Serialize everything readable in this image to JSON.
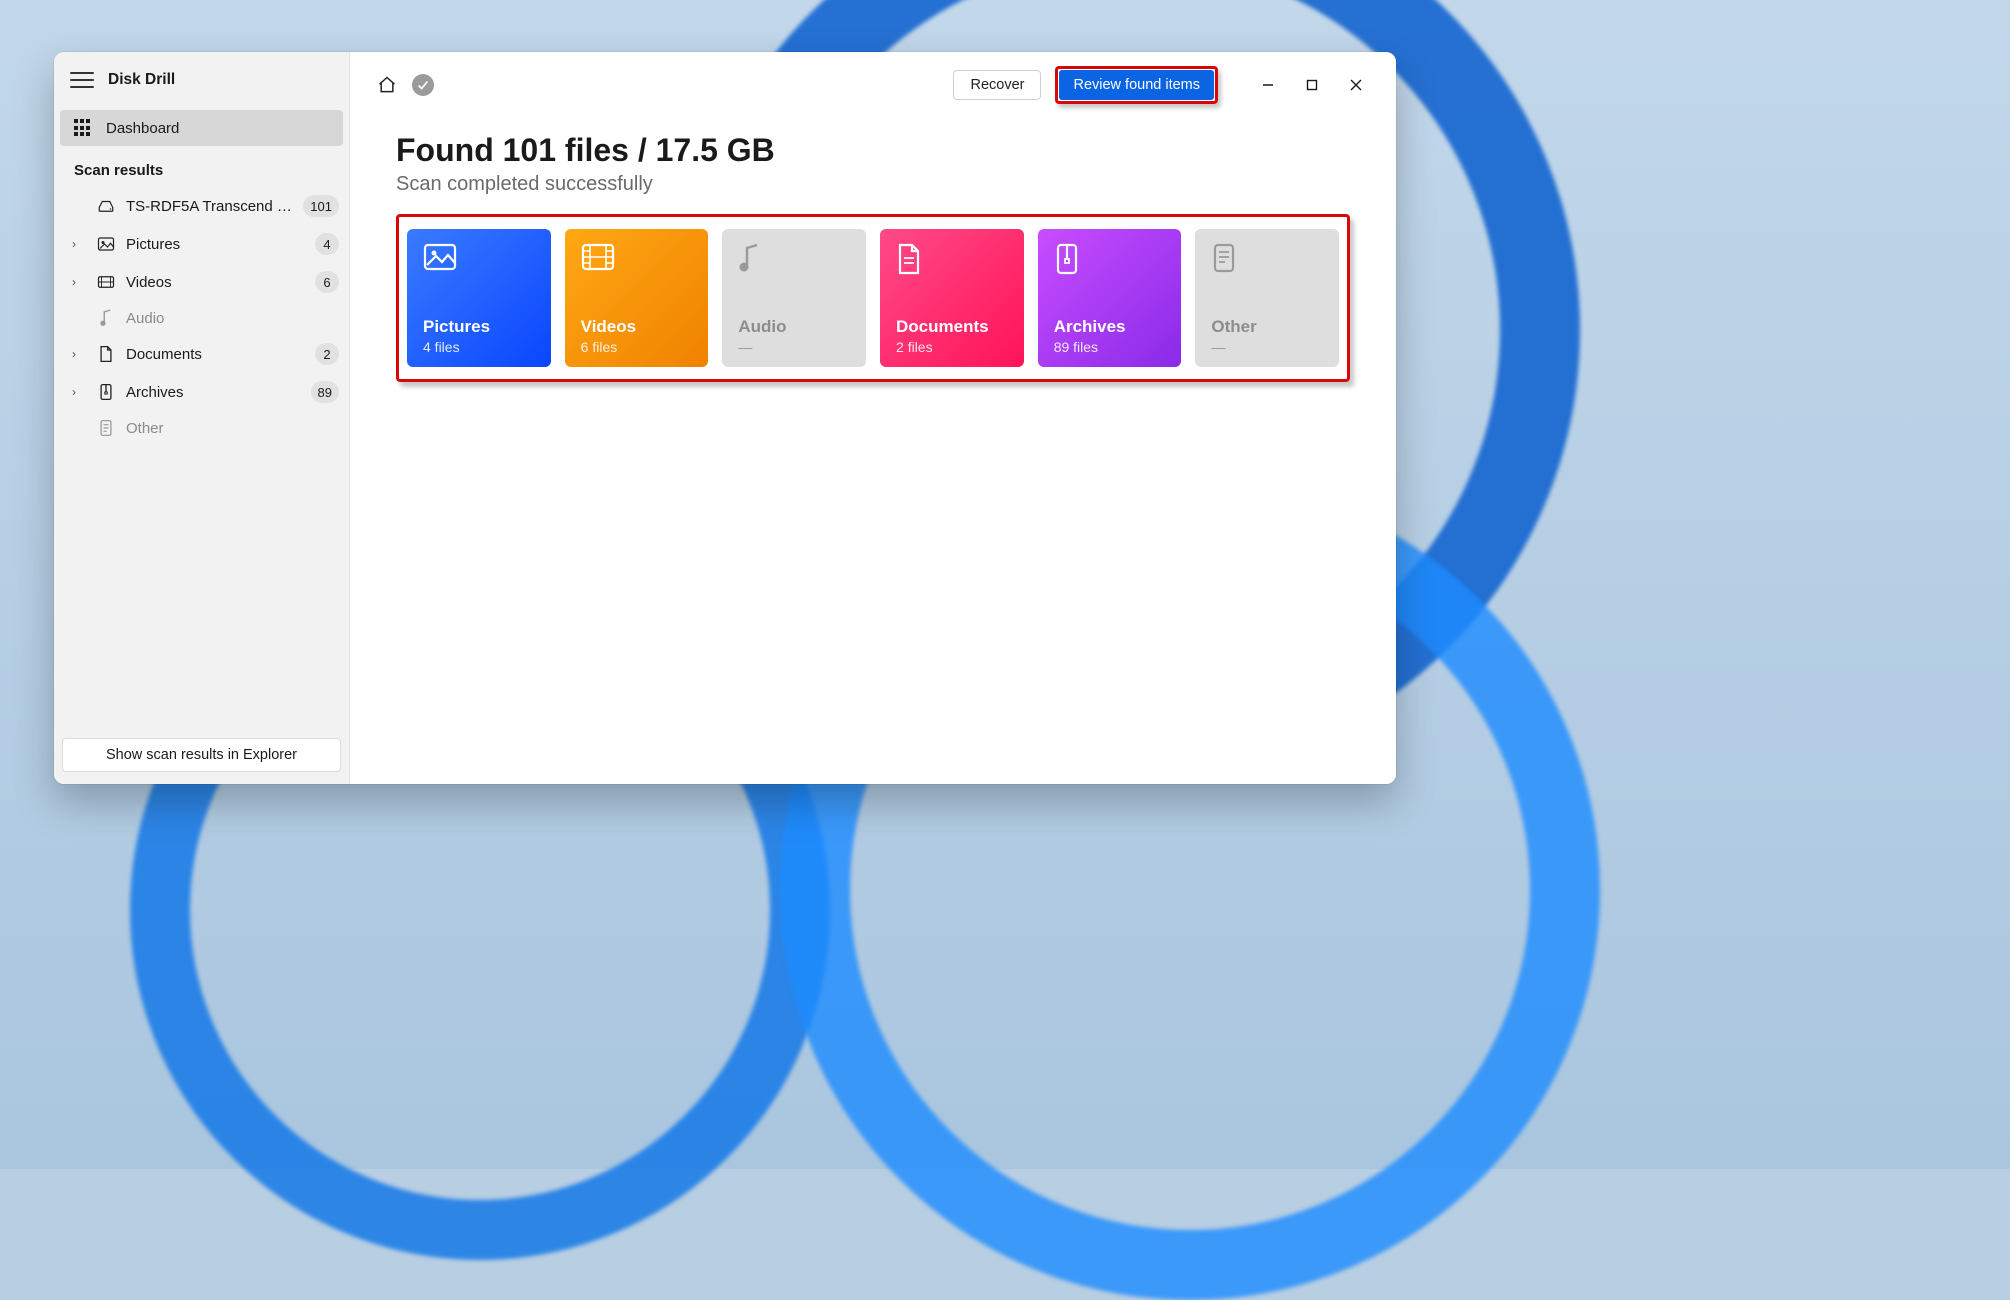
{
  "app": {
    "title": "Disk Drill"
  },
  "sidebar": {
    "dashboard_label": "Dashboard",
    "section_title": "Scan results",
    "items": [
      {
        "label": "TS-RDF5A Transcend US…",
        "count": "101"
      },
      {
        "label": "Pictures",
        "count": "4"
      },
      {
        "label": "Videos",
        "count": "6"
      },
      {
        "label": "Audio",
        "count": ""
      },
      {
        "label": "Documents",
        "count": "2"
      },
      {
        "label": "Archives",
        "count": "89"
      },
      {
        "label": "Other",
        "count": ""
      }
    ],
    "footer_button": "Show scan results in Explorer"
  },
  "topbar": {
    "recover_label": "Recover",
    "review_label": "Review found items"
  },
  "main": {
    "heading": "Found 101 files / 17.5 GB",
    "subheading": "Scan completed successfully"
  },
  "categories": [
    {
      "title": "Pictures",
      "subtitle": "4 files"
    },
    {
      "title": "Videos",
      "subtitle": "6 files"
    },
    {
      "title": "Audio",
      "subtitle": "—"
    },
    {
      "title": "Documents",
      "subtitle": "2 files"
    },
    {
      "title": "Archives",
      "subtitle": "89 files"
    },
    {
      "title": "Other",
      "subtitle": "—"
    }
  ]
}
